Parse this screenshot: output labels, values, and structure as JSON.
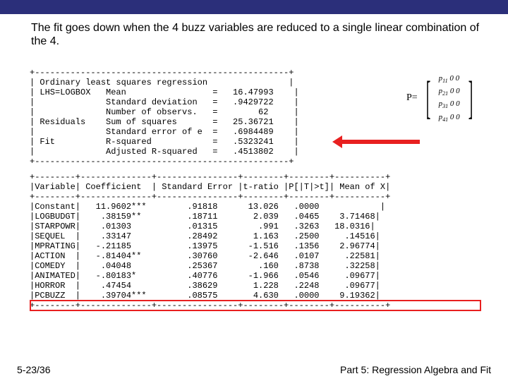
{
  "header": {},
  "description": "The fit goes down when the 4 buzz variables are reduced to a single linear combination of the 4.",
  "matrix_label": "P=",
  "regression_text": "+--------------------------------------------------+\n| Ordinary least squares regression                |\n| LHS=LOGBOX   Mean                 =   16.47993    |\n|              Standard deviation   =   .9429722    |\n|              Number of observs.   =        62     |\n| Residuals    Sum of squares       =   25.36721    |\n|              Standard error of e  =   .6984489    |\n| Fit          R-squared            =   .5323241    |\n|              Adjusted R-squared   =   .4513802    |\n+--------------------------------------------------+",
  "coef_text": "+--------+--------------+----------------+--------+--------+----------+\n|Variable| Coefficient  | Standard Error |t-ratio |P[|T|>t]| Mean of X|\n+--------+--------------+----------------+--------+--------+----------+\n|Constant|   11.9602***        .91818      13.026   .0000            |\n|LOGBUDGT|    .38159**         .18711       2.039   .0465    3.71468|\n|STARPOWR|    .01303           .01315        .991   .3263   18.0316|\n|SEQUEL  |    .33147           .28492       1.163   .2500     .14516|\n|MPRATING|   -.21185           .13975      -1.516   .1356    2.96774|\n|ACTION  |   -.81404**         .30760      -2.646   .0107     .22581|\n|COMEDY  |    .04048           .25367        .160   .8738     .32258|\n|ANIMATED|   -.80183*          .40776      -1.966   .0546     .09677|\n|HORROR  |    .47454           .38629       1.228   .2248     .09677|\n|PCBUZZ  |    .39704***        .08575       4.630   .0000    9.19362|\n+--------+--------------+----------------+--------+--------+----------+",
  "footer": {
    "left": "5-23/36",
    "right": "Part 5: Regression Algebra and Fit"
  },
  "chart_data": {
    "type": "table",
    "title": "Ordinary least squares regression",
    "dependent_variable": "LOGBOX",
    "summary": {
      "Mean": 16.47993,
      "Standard deviation": 0.9429722,
      "Number of observs.": 62,
      "Sum of squares": 25.36721,
      "Standard error of e": 0.6984489,
      "R-squared": 0.5323241,
      "Adjusted R-squared": 0.4513802
    },
    "columns": [
      "Variable",
      "Coefficient",
      "Standard Error",
      "t-ratio",
      "P[|T|>t]",
      "Mean of X"
    ],
    "rows": [
      {
        "Variable": "Constant",
        "Coefficient": 11.9602,
        "sig": "***",
        "Standard Error": 0.91818,
        "t-ratio": 13.026,
        "P": 0.0,
        "Mean of X": null
      },
      {
        "Variable": "LOGBUDGT",
        "Coefficient": 0.38159,
        "sig": "**",
        "Standard Error": 0.18711,
        "t-ratio": 2.039,
        "P": 0.0465,
        "Mean of X": 3.71468
      },
      {
        "Variable": "STARPOWR",
        "Coefficient": 0.01303,
        "sig": "",
        "Standard Error": 0.01315,
        "t-ratio": 0.991,
        "P": 0.3263,
        "Mean of X": 18.0316
      },
      {
        "Variable": "SEQUEL",
        "Coefficient": 0.33147,
        "sig": "",
        "Standard Error": 0.28492,
        "t-ratio": 1.163,
        "P": 0.25,
        "Mean of X": 0.14516
      },
      {
        "Variable": "MPRATING",
        "Coefficient": -0.21185,
        "sig": "",
        "Standard Error": 0.13975,
        "t-ratio": -1.516,
        "P": 0.1356,
        "Mean of X": 2.96774
      },
      {
        "Variable": "ACTION",
        "Coefficient": -0.81404,
        "sig": "**",
        "Standard Error": 0.3076,
        "t-ratio": -2.646,
        "P": 0.0107,
        "Mean of X": 0.22581
      },
      {
        "Variable": "COMEDY",
        "Coefficient": 0.04048,
        "sig": "",
        "Standard Error": 0.25367,
        "t-ratio": 0.16,
        "P": 0.8738,
        "Mean of X": 0.32258
      },
      {
        "Variable": "ANIMATED",
        "Coefficient": -0.80183,
        "sig": "*",
        "Standard Error": 0.40776,
        "t-ratio": -1.966,
        "P": 0.0546,
        "Mean of X": 0.09677
      },
      {
        "Variable": "HORROR",
        "Coefficient": 0.47454,
        "sig": "",
        "Standard Error": 0.38629,
        "t-ratio": 1.228,
        "P": 0.2248,
        "Mean of X": 0.09677
      },
      {
        "Variable": "PCBUZZ",
        "Coefficient": 0.39704,
        "sig": "***",
        "Standard Error": 0.08575,
        "t-ratio": 4.63,
        "P": 0.0,
        "Mean of X": 9.19362
      }
    ],
    "highlighted_row": "PCBUZZ",
    "annotation_arrow_target": "Fit R-squared",
    "matrix": {
      "label": "P",
      "rows": [
        "p11 0 0",
        "p21 0 0",
        "p31 0 0",
        "p41 0 0"
      ]
    }
  }
}
